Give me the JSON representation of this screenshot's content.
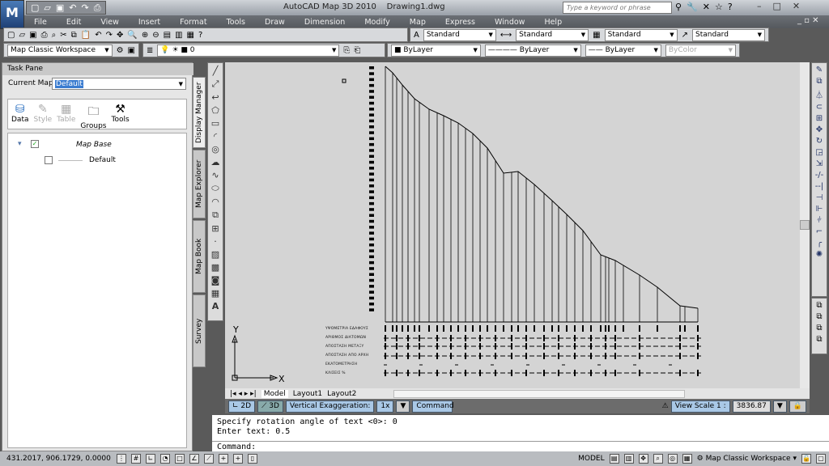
{
  "app": {
    "logo": "M",
    "logo_sub": "3D",
    "title": "AutoCAD Map 3D 2010",
    "document": "Drawing1.dwg"
  },
  "search": {
    "placeholder": "Type a keyword or phrase"
  },
  "menu": [
    "File",
    "Edit",
    "View",
    "Insert",
    "Format",
    "Tools",
    "Draw",
    "Dimension",
    "Modify",
    "Map",
    "Express",
    "Window",
    "Help"
  ],
  "styles": {
    "text_style": "Standard",
    "dim_style": "Standard",
    "table_style": "Standard",
    "mleader_style": "Standard"
  },
  "workspace": {
    "value": "Map Classic Workspace"
  },
  "layer": {
    "value": "0"
  },
  "properties": {
    "color": "ByLayer",
    "linetype": "ByLayer",
    "lineweight": "ByLayer",
    "plotstyle": "ByColor"
  },
  "task_pane": {
    "title": "Task Pane",
    "current_map_label": "Current Map:",
    "current_map": "Default",
    "tools": [
      "Data",
      "Style",
      "Table",
      "Groups",
      "Tools"
    ],
    "tree": {
      "group": "Map Base",
      "item": "Default"
    },
    "side_tabs": [
      "Display Manager",
      "Map Explorer",
      "Map Book",
      "Survey"
    ]
  },
  "drawing": {
    "band_labels": [
      "ΥΨΟΜΕΤΡΙΑ ΕΔΑΦΟΥΣ",
      "ΑΡΙΘΜΟΣ ΔΙΑΤΟΜΩΝ",
      "ΑΠΟΣΤΑΣΗ ΜΕΤΑΞΥ",
      "ΑΠΟΣΤΑΣΗ ΑΠΟ ΑΡΧΗ",
      "ΕΚΑΤΟΜΕΤΡΗΣΗ",
      "ΚΛΙΣΕΙΣ %"
    ],
    "ucs_x": "X",
    "ucs_y": "Y"
  },
  "layout_tabs": [
    "Model",
    "Layout1",
    "Layout2"
  ],
  "map_bar": {
    "btn_2d": "2D",
    "btn_3d": "3D",
    "vert_exag_label": "Vertical Exaggeration:",
    "vert_exag": "1x",
    "command": "Command",
    "view_scale_label": "View Scale  1 :",
    "view_scale": "3836.87"
  },
  "command": {
    "history": [
      "Specify rotation angle of text <0>: 0",
      "Enter text: 0.5"
    ],
    "prompt": "Command:"
  },
  "status": {
    "coords": "431.2017, 906.1729, 0.0000",
    "model": "MODEL",
    "workspace": "Map Classic Workspace"
  }
}
